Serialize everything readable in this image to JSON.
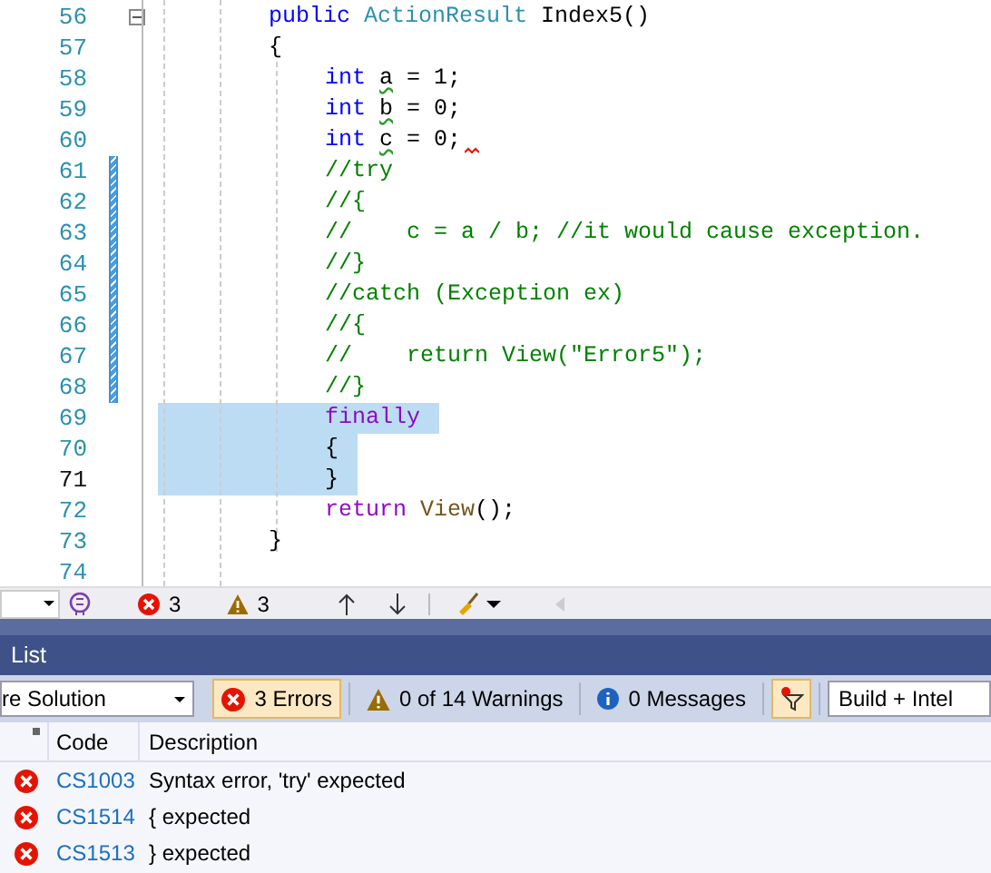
{
  "editor": {
    "lines": [
      {
        "number": "56",
        "fold": true,
        "changed": false,
        "current": false,
        "selected": false,
        "tokens": [
          {
            "text": "public ",
            "kind": "keyword"
          },
          {
            "text": "ActionResult",
            "kind": "type"
          },
          {
            "text": " Index5()",
            "kind": "plain"
          }
        ]
      },
      {
        "number": "57",
        "fold": false,
        "changed": false,
        "current": false,
        "selected": false,
        "tokens": [
          {
            "text": "{",
            "kind": "plain"
          }
        ],
        "children": [
          {
            "number": "58",
            "fold": false,
            "changed": false,
            "current": false,
            "selected": false,
            "tokens": [
              {
                "text": "int ",
                "kind": "keyword"
              },
              {
                "text": "a",
                "kind": "plain",
                "warning_squiggle": true
              },
              {
                "text": " = 1;",
                "kind": "plain"
              }
            ]
          },
          {
            "number": "59",
            "fold": false,
            "changed": false,
            "current": false,
            "selected": false,
            "tokens": [
              {
                "text": "int ",
                "kind": "keyword"
              },
              {
                "text": "b",
                "kind": "plain",
                "warning_squiggle": true
              },
              {
                "text": " = 0;",
                "kind": "plain"
              }
            ]
          },
          {
            "number": "60",
            "fold": false,
            "changed": false,
            "current": false,
            "selected": false,
            "error_after": true,
            "tokens": [
              {
                "text": "int ",
                "kind": "keyword"
              },
              {
                "text": "c",
                "kind": "plain",
                "warning_squiggle": true
              },
              {
                "text": " = 0;",
                "kind": "plain"
              }
            ]
          },
          {
            "number": "61",
            "fold": false,
            "changed": true,
            "current": false,
            "selected": false,
            "tokens": [
              {
                "text": "//try",
                "kind": "comment"
              }
            ]
          },
          {
            "number": "62",
            "fold": false,
            "changed": true,
            "current": false,
            "selected": false,
            "tokens": [
              {
                "text": "//{",
                "kind": "comment"
              }
            ]
          },
          {
            "number": "63",
            "fold": false,
            "changed": true,
            "current": false,
            "selected": false,
            "tokens": [
              {
                "text": "//    c = a / b; //it would cause exception.",
                "kind": "comment"
              }
            ]
          },
          {
            "number": "64",
            "fold": false,
            "changed": true,
            "current": false,
            "selected": false,
            "tokens": [
              {
                "text": "//}",
                "kind": "comment"
              }
            ]
          },
          {
            "number": "65",
            "fold": false,
            "changed": true,
            "current": false,
            "selected": false,
            "tokens": [
              {
                "text": "//catch (Exception ex)",
                "kind": "comment"
              }
            ]
          },
          {
            "number": "66",
            "fold": false,
            "changed": true,
            "current": false,
            "selected": false,
            "tokens": [
              {
                "text": "//{",
                "kind": "comment"
              }
            ]
          },
          {
            "number": "67",
            "fold": false,
            "changed": true,
            "current": false,
            "selected": false,
            "tokens": [
              {
                "text": "//    return View(\"Error5\");",
                "kind": "comment"
              }
            ]
          },
          {
            "number": "68",
            "fold": false,
            "changed": true,
            "current": false,
            "selected": false,
            "tokens": [
              {
                "text": "//}",
                "kind": "comment"
              }
            ]
          },
          {
            "number": "69",
            "fold": false,
            "changed": false,
            "current": false,
            "selected": true,
            "tokens": [
              {
                "text": "finally",
                "kind": "control"
              }
            ]
          },
          {
            "number": "70",
            "fold": false,
            "changed": false,
            "current": false,
            "selected": true,
            "tokens": [
              {
                "text": "{",
                "kind": "plain"
              }
            ]
          },
          {
            "number": "71",
            "fold": false,
            "changed": false,
            "current": true,
            "selected": true,
            "tokens": [
              {
                "text": "}",
                "kind": "plain"
              }
            ]
          },
          {
            "number": "72",
            "fold": false,
            "changed": false,
            "current": false,
            "selected": false,
            "tokens": [
              {
                "text": "return ",
                "kind": "control"
              },
              {
                "text": "View",
                "kind": "method"
              },
              {
                "text": "();",
                "kind": "plain"
              }
            ]
          }
        ]
      },
      {
        "number": "73",
        "fold": false,
        "changed": false,
        "current": false,
        "selected": false,
        "tokens": [
          {
            "text": "}",
            "kind": "plain"
          }
        ]
      },
      {
        "number": "74",
        "fold": false,
        "changed": false,
        "current": false,
        "selected": false
      }
    ]
  },
  "status_bar": {
    "errors": "3",
    "warnings": "3"
  },
  "error_list": {
    "title": "List",
    "scope": "re Solution",
    "filters": [
      {
        "kind": "error",
        "label": "3 Errors",
        "selected": true
      },
      {
        "kind": "warning",
        "label": "0 of 14 Warnings",
        "selected": false
      },
      {
        "kind": "info",
        "label": "0 Messages",
        "selected": false
      }
    ],
    "filter_toggle": {
      "selected": true
    },
    "source": "Build + Intel",
    "columns": [
      "Code",
      "Description"
    ],
    "rows": [
      {
        "code": "CS1003",
        "description": "Syntax error, 'try' expected"
      },
      {
        "code": "CS1514",
        "description": "{ expected"
      },
      {
        "code": "CS1513",
        "description": "} expected"
      }
    ]
  }
}
